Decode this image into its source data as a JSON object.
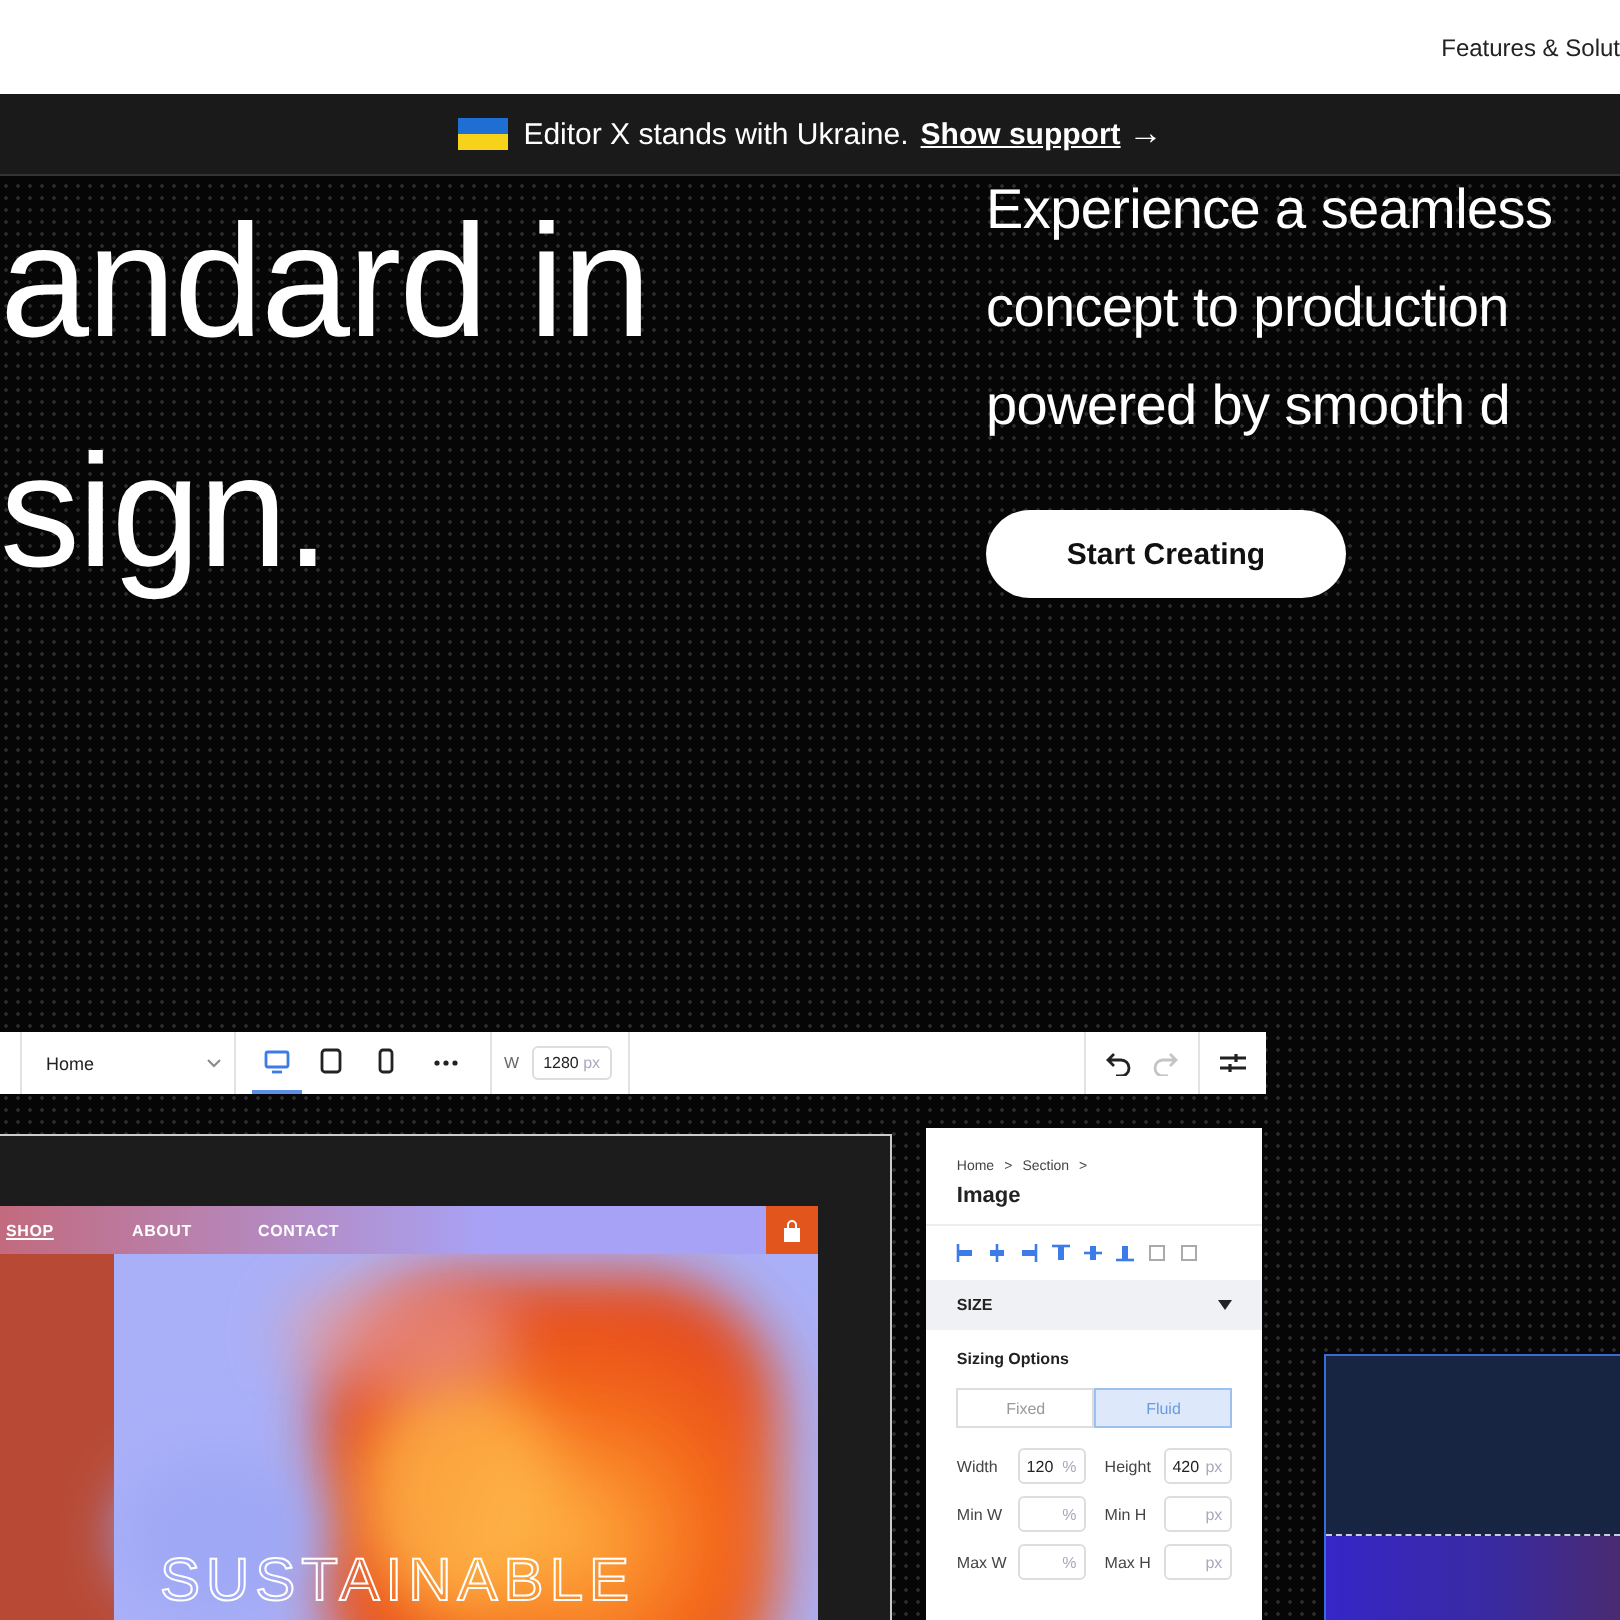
{
  "top_nav": {
    "link": "Features & Solut"
  },
  "banner": {
    "text": "Editor X stands with Ukraine.",
    "link": "Show support",
    "arrow": "→"
  },
  "hero": {
    "heading_lines": [
      "andard in",
      "sign."
    ],
    "paragraph_lines": [
      "Experience a seamless",
      "concept to production",
      "powered by smooth d"
    ],
    "button": "Start Creating"
  },
  "editor": {
    "toolbar": {
      "page": "Home",
      "devices": [
        {
          "kind": "desktop",
          "selected": true
        },
        {
          "kind": "tablet",
          "selected": false
        },
        {
          "kind": "mobile",
          "selected": false
        }
      ],
      "width_label": "W",
      "width_value": "1280",
      "width_unit": "px",
      "undo": {
        "disabled": false
      },
      "redo": {
        "disabled": true
      }
    },
    "site_preview": {
      "nav": [
        {
          "label": "SHOP",
          "selected": true
        },
        {
          "label": "ABOUT",
          "selected": false
        },
        {
          "label": "CONTACT",
          "selected": false
        }
      ],
      "headline": "SUSTAINABLE"
    },
    "inspector": {
      "breadcrumb": [
        "Home",
        "Section"
      ],
      "separator": ">",
      "title": "Image",
      "section": {
        "label": "SIZE",
        "expanded": true
      },
      "sizing_label": "Sizing Options",
      "sizing_options": [
        {
          "label": "Fixed",
          "selected": false
        },
        {
          "label": "Fluid",
          "selected": true
        }
      ],
      "fields": [
        {
          "label": "Width",
          "value": "120",
          "unit": "%"
        },
        {
          "label": "Height",
          "value": "420",
          "unit": "px"
        },
        {
          "label": "Min W",
          "unit": "%"
        },
        {
          "label": "Min H",
          "unit": "px"
        },
        {
          "label": "Max W",
          "unit": "%"
        },
        {
          "label": "Max H",
          "unit": "px"
        }
      ]
    }
  }
}
